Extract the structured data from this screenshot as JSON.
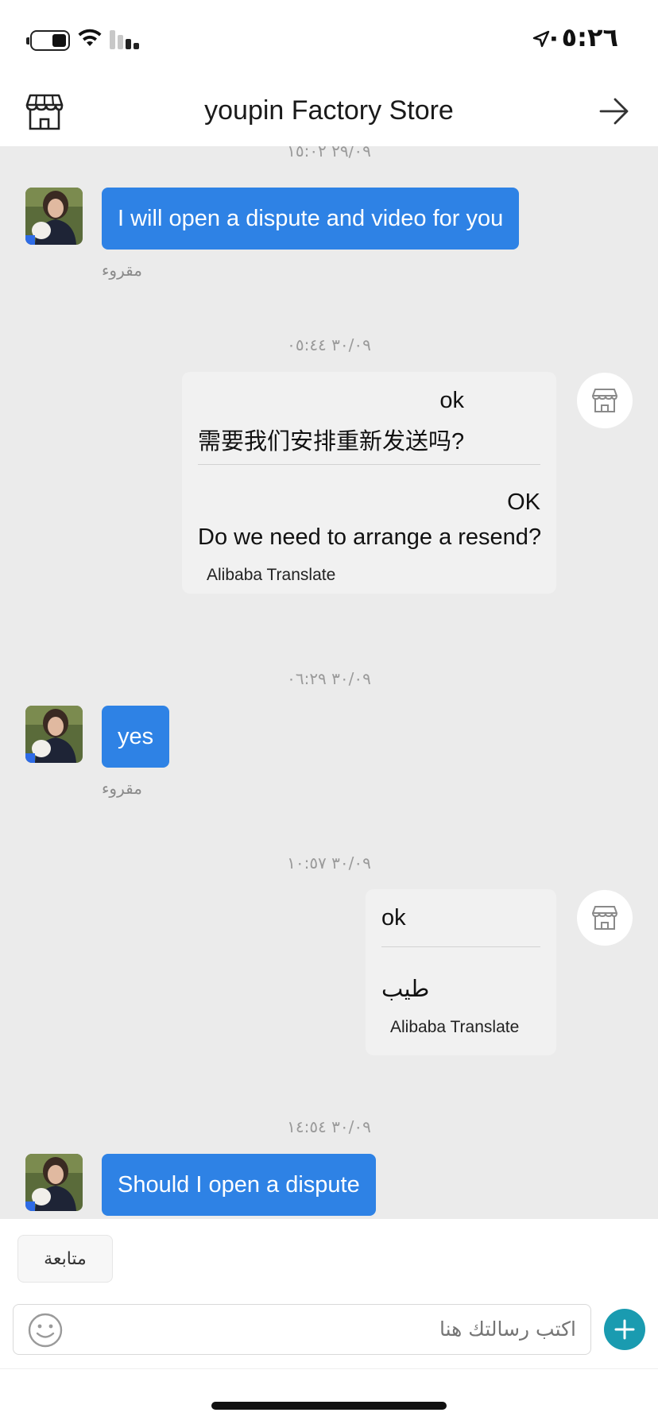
{
  "status_bar": {
    "time": "٠٥:٢٦",
    "icons": [
      "battery-icon",
      "wifi-icon",
      "signal-icon",
      "location-arrow-icon"
    ]
  },
  "header": {
    "title": "youpin Factory Store",
    "left_icon": "store-icon",
    "right_icon": "forward-arrow-icon"
  },
  "messages": [
    {
      "timestamp": "٢٩/٠٩ ١٥:٠٢"
    },
    {
      "from": "me",
      "text": "I will open a dispute and video for you",
      "status": "مقروء"
    },
    {
      "timestamp": "٣٠/٠٩ ٠٥:٤٤"
    },
    {
      "from": "store",
      "original": [
        "ok",
        "需要我们安排重新发送吗?"
      ],
      "translated": [
        "OK",
        "Do we need to arrange a resend?"
      ],
      "credit": "Alibaba Translate"
    },
    {
      "timestamp": "٣٠/٠٩ ٠٦:٢٩"
    },
    {
      "from": "me",
      "text": "yes",
      "status": "مقروء"
    },
    {
      "timestamp": "٣٠/٠٩ ١٠:٥٧"
    },
    {
      "from": "store",
      "original": [
        "ok"
      ],
      "translated": [
        "طيب"
      ],
      "credit": "Alibaba Translate"
    },
    {
      "timestamp": "٣٠/٠٩ ١٤:٥٤"
    },
    {
      "from": "me",
      "text": "Should I open a dispute"
    }
  ],
  "quick_reply": {
    "label": "متابعة"
  },
  "composer": {
    "placeholder": "اكتب رسالتك هنا",
    "emoji_icon": "emoji-icon",
    "add_icon": "plus-icon"
  },
  "colors": {
    "my_bubble": "#2e82e5",
    "chat_background": "#ebebeb",
    "their_bubble": "#f1f1f1",
    "add_button": "#1a9bb0"
  }
}
